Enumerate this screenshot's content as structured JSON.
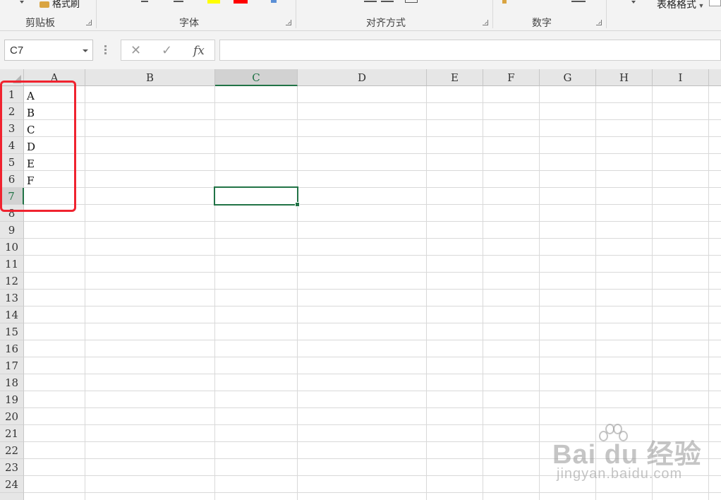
{
  "ribbon": {
    "format_painter_label": "格式刷",
    "table_format_label": "表格格式",
    "groups": [
      {
        "label": "剪贴板"
      },
      {
        "label": "字体"
      },
      {
        "label": "对齐方式"
      },
      {
        "label": "数字"
      }
    ],
    "font_highlight_color": "#ffff00",
    "font_color": "#ff0000"
  },
  "formula_bar": {
    "name_box": "C7",
    "cancel_glyph": "✕",
    "enter_glyph": "✓",
    "fx_label": "fx",
    "formula_value": ""
  },
  "sheet": {
    "columns": [
      "A",
      "B",
      "C",
      "D",
      "E",
      "F",
      "G",
      "H",
      "I"
    ],
    "selected_column": "C",
    "rows": [
      "1",
      "2",
      "3",
      "4",
      "5",
      "6",
      "7",
      "8",
      "9",
      "10",
      "11",
      "12",
      "13",
      "14",
      "15",
      "16",
      "17",
      "18",
      "19",
      "20",
      "21",
      "22",
      "23",
      "24"
    ],
    "selected_row": "7",
    "cells": [
      {
        "ref": "A1",
        "value": "A"
      },
      {
        "ref": "A2",
        "value": "B"
      },
      {
        "ref": "A3",
        "value": "C"
      },
      {
        "ref": "A4",
        "value": "D"
      },
      {
        "ref": "A5",
        "value": "E"
      },
      {
        "ref": "A6",
        "value": "F"
      }
    ],
    "active_cell": "C7",
    "accent_color": "#217346",
    "annotation_color": "#f0232f"
  },
  "watermark": {
    "logo_text": "Bai du 经验",
    "url": "jingyan.baidu.com"
  }
}
